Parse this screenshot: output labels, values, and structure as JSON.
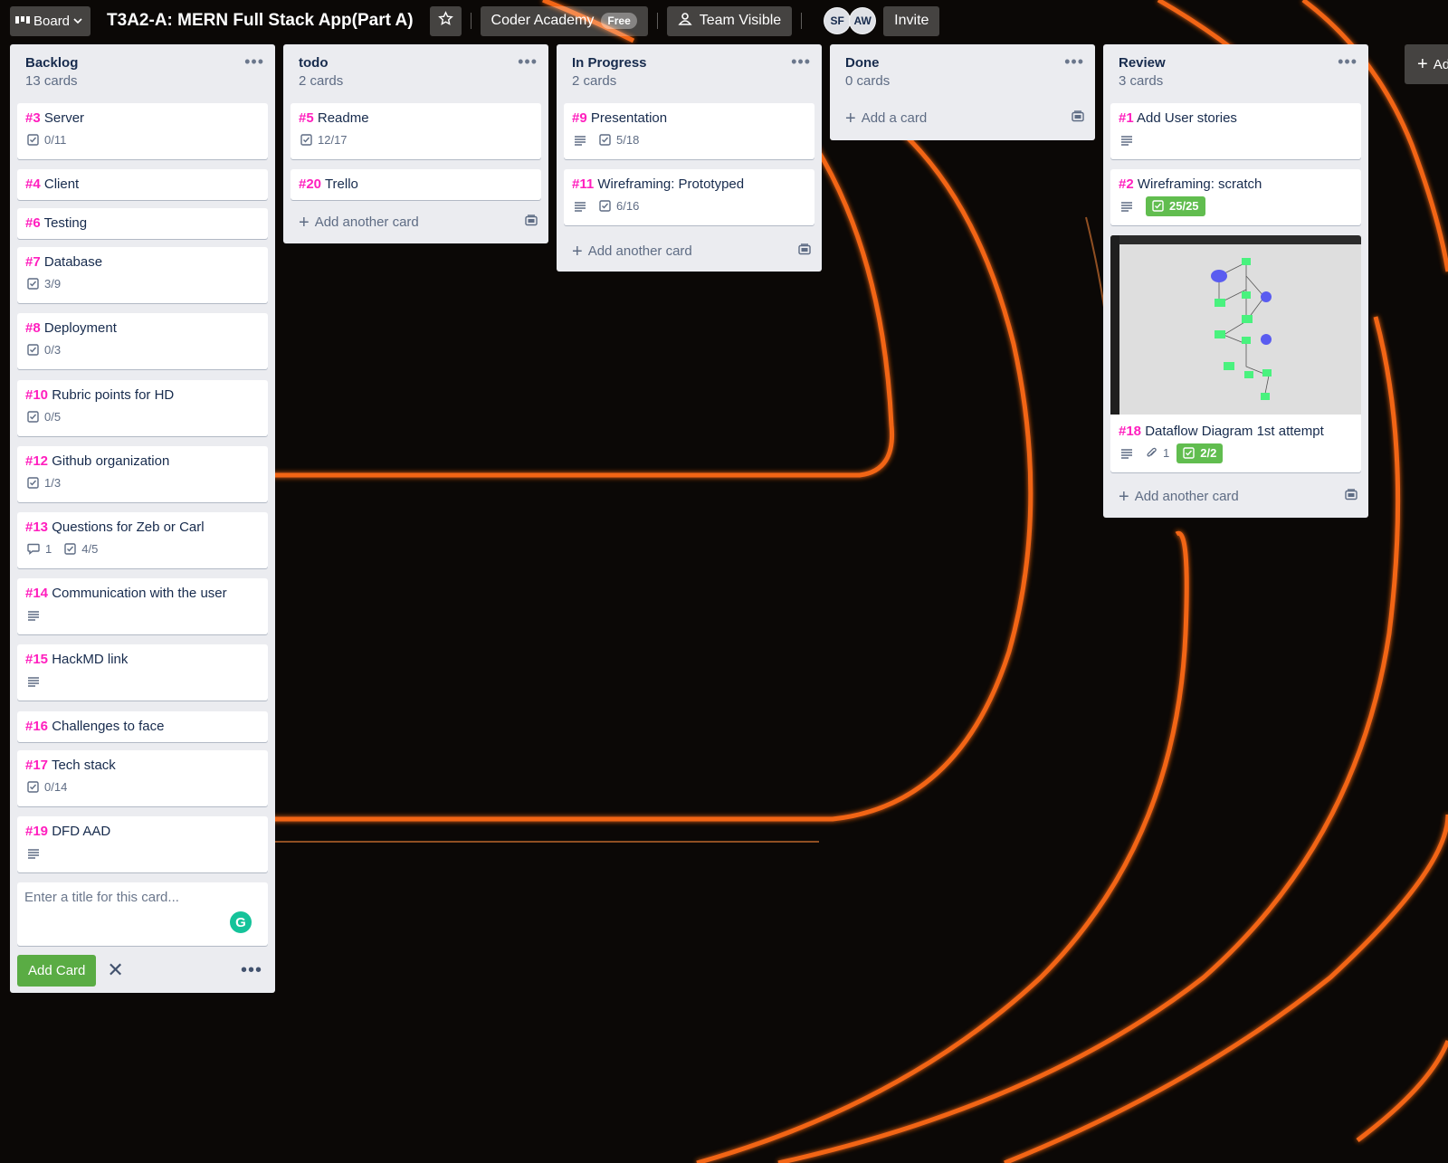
{
  "header": {
    "board_switch_label": "Board",
    "board_title": "T3A2-A: MERN Full Stack App(Part A)",
    "team_label": "Coder Academy",
    "team_badge": "Free",
    "visibility_label": "Team Visible",
    "members": [
      "SF",
      "AW"
    ],
    "invite_label": "Invite"
  },
  "lists": {
    "backlog": {
      "title": "Backlog",
      "count": "13 cards",
      "cards": [
        {
          "num": "#3",
          "title": "Server",
          "checklist": "0/11"
        },
        {
          "num": "#4",
          "title": "Client"
        },
        {
          "num": "#6",
          "title": "Testing"
        },
        {
          "num": "#7",
          "title": "Database",
          "checklist": "3/9"
        },
        {
          "num": "#8",
          "title": "Deployment",
          "checklist": "0/3"
        },
        {
          "num": "#10",
          "title": "Rubric points for HD",
          "checklist": "0/5"
        },
        {
          "num": "#12",
          "title": "Github organization",
          "checklist": "1/3"
        },
        {
          "num": "#13",
          "title": "Questions for Zeb or Carl",
          "comments": "1",
          "checklist": "4/5"
        },
        {
          "num": "#14",
          "title": "Communication with the user"
        },
        {
          "num": "#15",
          "title": "HackMD link"
        },
        {
          "num": "#16",
          "title": "Challenges to face"
        },
        {
          "num": "#17",
          "title": "Tech stack",
          "checklist": "0/14"
        },
        {
          "num": "#19",
          "title": "DFD AAD"
        }
      ],
      "composer_placeholder": "Enter a title for this card...",
      "add_button": "Add Card"
    },
    "todo": {
      "title": "todo",
      "count": "2 cards",
      "cards": [
        {
          "num": "#5",
          "title": "Readme",
          "checklist": "12/17"
        },
        {
          "num": "#20",
          "title": "Trello"
        }
      ],
      "add_label": "Add another card"
    },
    "in_progress": {
      "title": "In Progress",
      "count": "2 cards",
      "cards": [
        {
          "num": "#9",
          "title": "Presentation",
          "checklist": "5/18"
        },
        {
          "num": "#11",
          "title": "Wireframing: Prototyped",
          "checklist": "6/16"
        }
      ],
      "add_label": "Add another card"
    },
    "done": {
      "title": "Done",
      "count": "0 cards",
      "add_label": "Add a card"
    },
    "review": {
      "title": "Review",
      "count": "3 cards",
      "cards": [
        {
          "num": "#1",
          "title": "Add User stories"
        },
        {
          "num": "#2",
          "title": "Wireframing: scratch",
          "checklist": "25/25"
        },
        {
          "num": "#18",
          "title": "Dataflow Diagram 1st attempt",
          "attachments": "1",
          "checklist": "2/2"
        }
      ],
      "add_label": "Add another card"
    }
  },
  "add_list_label": "Ad",
  "colors": {
    "card_number": "#ff1fbe",
    "list_bg": "#ebecf0",
    "complete_badge": "#61bd4f",
    "add_button": "#5aac44",
    "background_glow": "#ff6a14"
  }
}
